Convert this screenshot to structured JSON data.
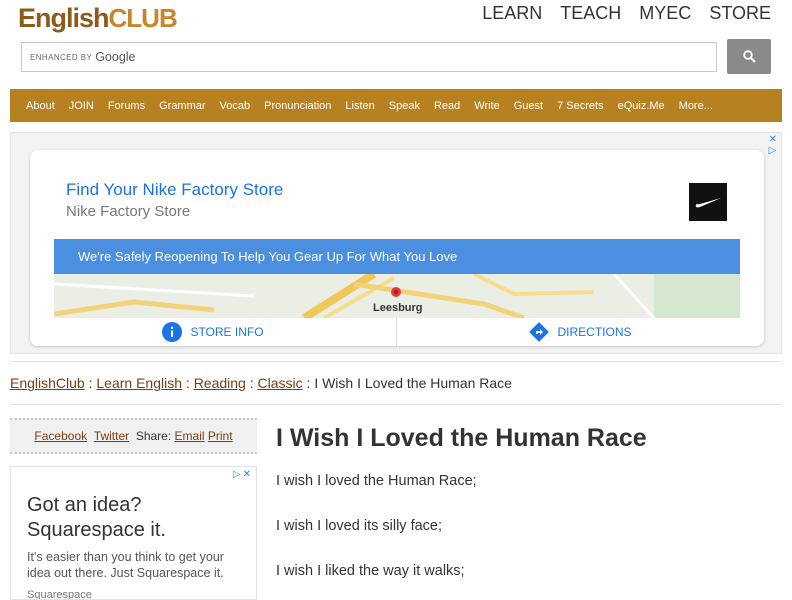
{
  "header": {
    "logo_part1": "English",
    "logo_part2": "CLUB",
    "nav": [
      "LEARN",
      "TEACH",
      "MYEC",
      "STORE"
    ]
  },
  "search": {
    "enhanced_label": "ENHANCED BY",
    "google_label": "Google",
    "button_icon": "search-icon"
  },
  "navbar": [
    "About",
    "JOIN",
    "Forums",
    "Grammar",
    "Vocab",
    "Pronunciation",
    "Listen",
    "Speak",
    "Read",
    "Write",
    "Guest",
    "7 Secrets",
    "eQuiz.Me",
    "More..."
  ],
  "ad1": {
    "title": "Find Your Nike Factory Store",
    "subtitle": "Nike Factory Store",
    "banner": "We're Safely Reopening To Help You Gear Up For What You Love",
    "map_label": "Leesburg",
    "store_info": "STORE INFO",
    "directions": "DIRECTIONS",
    "accent_color": "#1a73e8"
  },
  "breadcrumb": {
    "items": [
      "EnglishClub",
      "Learn English",
      "Reading",
      "Classic"
    ],
    "current": "I Wish I Loved the Human Race"
  },
  "share": {
    "facebook": "Facebook",
    "twitter": "Twitter",
    "share_label": "Share:",
    "email": "Email",
    "print": "Print"
  },
  "ad2": {
    "headline_line1": "Got an idea?",
    "headline_line2": "Squarespace it.",
    "body": "It's easier than you think to get your idea out there. Just Squarespace it.",
    "brand": "Squarespace"
  },
  "article": {
    "title": "I Wish I Loved the Human Race",
    "lines": [
      "I wish I loved the Human Race;",
      "I wish I loved its silly face;",
      "I wish I liked the way it walks;"
    ]
  },
  "colors": {
    "navbar_bg": "#b78121",
    "link": "#7a3c10"
  }
}
